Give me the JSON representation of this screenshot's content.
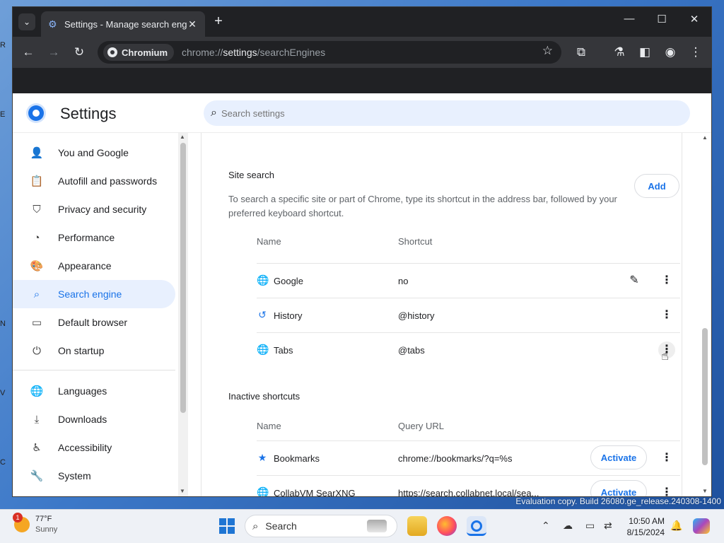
{
  "browser": {
    "tab_title": "Settings - Manage search engi",
    "site_chip": "Chromium",
    "url_prefix": "chrome://",
    "url_highlight": "settings",
    "url_suffix": "/searchEngines"
  },
  "settings": {
    "title": "Settings",
    "search_placeholder": "Search settings"
  },
  "nav": [
    {
      "label": "You and Google",
      "icon": "person-icon"
    },
    {
      "label": "Autofill and passwords",
      "icon": "clipboard-icon"
    },
    {
      "label": "Privacy and security",
      "icon": "shield-icon"
    },
    {
      "label": "Performance",
      "icon": "speedometer-icon"
    },
    {
      "label": "Appearance",
      "icon": "palette-icon"
    },
    {
      "label": "Search engine",
      "icon": "search-icon",
      "active": true
    },
    {
      "label": "Default browser",
      "icon": "browser-icon"
    },
    {
      "label": "On startup",
      "icon": "power-icon"
    },
    {
      "label": "Languages",
      "icon": "globe-icon"
    },
    {
      "label": "Downloads",
      "icon": "download-icon"
    },
    {
      "label": "Accessibility",
      "icon": "accessibility-icon"
    },
    {
      "label": "System",
      "icon": "wrench-icon"
    }
  ],
  "site_search": {
    "title": "Site search",
    "description": "To search a specific site or part of Chrome, type its shortcut in the address bar, followed by your preferred keyboard shortcut.",
    "add_label": "Add",
    "col_name": "Name",
    "col_shortcut": "Shortcut",
    "rows": [
      {
        "name": "Google",
        "value": "no",
        "icon": "globe-icon"
      },
      {
        "name": "History",
        "value": "@history",
        "icon": "history-icon"
      },
      {
        "name": "Tabs",
        "value": "@tabs",
        "icon": "globe-icon"
      }
    ]
  },
  "inactive": {
    "title": "Inactive shortcuts",
    "col_name": "Name",
    "col_url": "Query URL",
    "activate_label": "Activate",
    "rows": [
      {
        "name": "Bookmarks",
        "value": "chrome://bookmarks/?q=%s",
        "icon": "star-icon"
      },
      {
        "name": "CollabVM SearXNG",
        "value": "https://search.collabnet.local/sea...",
        "icon": "globe-icon"
      }
    ]
  },
  "taskbar": {
    "weather_temp": "77°F",
    "weather_cond": "Sunny",
    "weather_badge": "1",
    "search_label": "Search",
    "time": "10:50 AM",
    "date": "8/15/2024"
  },
  "watermark": "Evaluation copy. Build 26080.ge_release.240308-1400",
  "colors": {
    "accent": "#1a73e8",
    "active_nav_bg": "#e8f0fe",
    "titlebar": "#202124"
  }
}
